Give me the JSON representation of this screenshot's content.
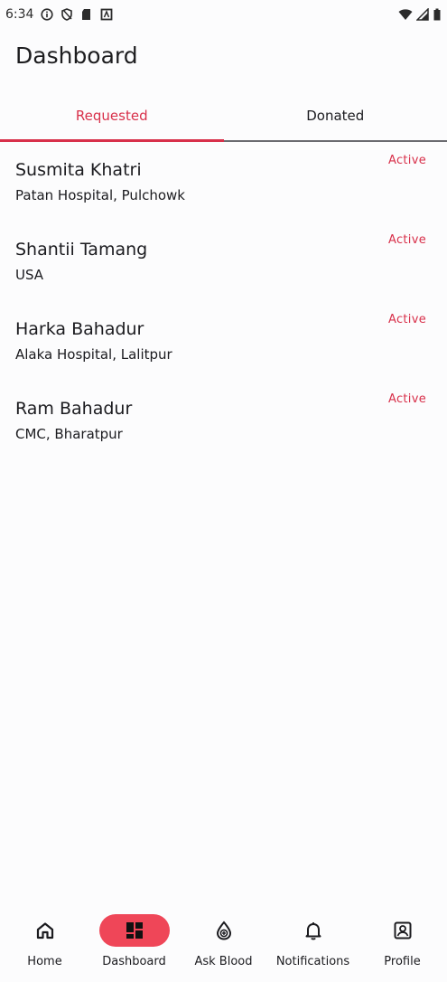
{
  "status_bar": {
    "time": "6:34",
    "left_icons": [
      "info-icon",
      "shield-icon",
      "sd-card-icon",
      "a-box-icon"
    ],
    "right_icons": [
      "wifi-icon",
      "cell-signal-icon",
      "battery-icon"
    ]
  },
  "header": {
    "title": "Dashboard"
  },
  "tabs": [
    {
      "label": "Requested",
      "active": true
    },
    {
      "label": "Donated",
      "active": false
    }
  ],
  "requests": [
    {
      "name": "Susmita Khatri",
      "location": "Patan Hospital, Pulchowk",
      "status": "Active"
    },
    {
      "name": "Shantii Tamang",
      "location": "USA",
      "status": "Active"
    },
    {
      "name": "Harka Bahadur",
      "location": "Alaka Hospital, Lalitpur",
      "status": "Active"
    },
    {
      "name": "Ram Bahadur",
      "location": "CMC, Bharatpur",
      "status": "Active"
    }
  ],
  "bottom_nav": [
    {
      "label": "Home",
      "icon": "home-icon",
      "active": false
    },
    {
      "label": "Dashboard",
      "icon": "dashboard-icon",
      "active": true
    },
    {
      "label": "Ask Blood",
      "icon": "blood-drop-icon",
      "active": false
    },
    {
      "label": "Notifications",
      "icon": "bell-icon",
      "active": false
    },
    {
      "label": "Profile",
      "icon": "profile-icon",
      "active": false
    }
  ],
  "colors": {
    "accent": "#d8304a",
    "active_pill": "#ef4658",
    "background": "#fcfcfd",
    "text": "#1b1b1f"
  }
}
